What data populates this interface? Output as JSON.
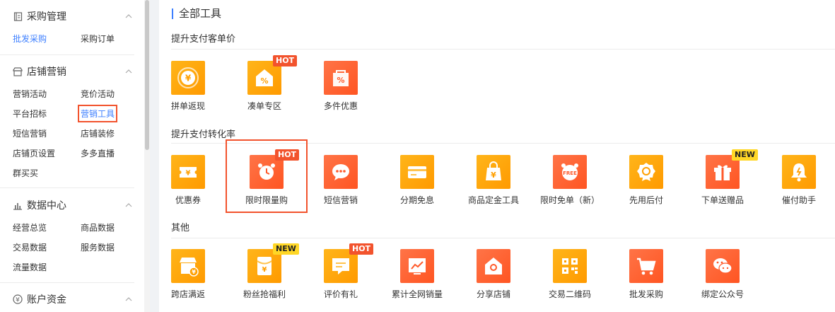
{
  "sidebar": {
    "sections": [
      {
        "title": "采购管理",
        "icon": "document-icon",
        "items": [
          "批发采购",
          "采购订单"
        ]
      },
      {
        "title": "店铺营销",
        "icon": "shop-icon",
        "items": [
          "营销活动",
          "竞价活动",
          "平台招标",
          "营销工具",
          "短信营销",
          "店铺装修",
          "店铺页设置",
          "多多直播",
          "群买买"
        ]
      },
      {
        "title": "数据中心",
        "icon": "bar-chart-icon",
        "items": [
          "经营总览",
          "商品数据",
          "交易数据",
          "服务数据",
          "流量数据"
        ]
      },
      {
        "title": "账户资金",
        "icon": "yen-circle-icon",
        "items": []
      }
    ]
  },
  "main": {
    "title": "全部工具",
    "groups": [
      {
        "title": "提升支付客单价",
        "tools": [
          {
            "label": "拼单返现",
            "icon": "yen-medal-icon"
          },
          {
            "label": "凑单专区",
            "icon": "discount-house-icon",
            "badge": "HOT"
          },
          {
            "label": "多件优惠",
            "icon": "discount-bag-icon"
          }
        ]
      },
      {
        "title": "提升支付转化率",
        "tools": [
          {
            "label": "优惠券",
            "icon": "coupon-icon"
          },
          {
            "label": "限时限量购",
            "icon": "alarm-clock-icon",
            "badge": "HOT"
          },
          {
            "label": "短信营销",
            "icon": "chat-bubble-icon"
          },
          {
            "label": "分期免息",
            "icon": "credit-card-icon"
          },
          {
            "label": "商品定金工具",
            "icon": "yen-bag-icon"
          },
          {
            "label": "限时免单（新）",
            "icon": "free-alarm-icon"
          },
          {
            "label": "先用后付",
            "icon": "badge-check-icon"
          },
          {
            "label": "下单送赠品",
            "icon": "gift-icon",
            "badge": "NEW"
          },
          {
            "label": "催付助手",
            "icon": "bell-icon"
          }
        ]
      },
      {
        "title": "其他",
        "tools": [
          {
            "label": "跨店满返",
            "icon": "store-yen-icon"
          },
          {
            "label": "粉丝抢福利",
            "icon": "red-envelope-icon",
            "badge": "NEW"
          },
          {
            "label": "评价有礼",
            "icon": "comment-icon",
            "badge": "HOT"
          },
          {
            "label": "累计全网销量",
            "icon": "trend-chart-icon"
          },
          {
            "label": "分享店铺",
            "icon": "share-shop-icon"
          },
          {
            "label": "交易二维码",
            "icon": "qr-code-icon"
          },
          {
            "label": "批发采购",
            "icon": "cart-icon"
          },
          {
            "label": "绑定公众号",
            "icon": "wechat-icon"
          }
        ]
      }
    ]
  }
}
